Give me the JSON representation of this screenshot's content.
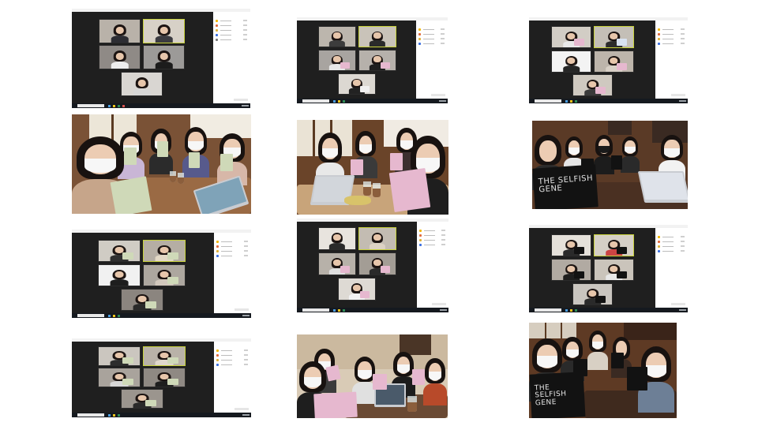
{
  "image": {
    "description_words": "collage of twelve photos and video-call screenshots of a reading group holding books",
    "grid": {
      "rows": 4,
      "columns": 3
    }
  },
  "book_cover": {
    "title": "THE SELFISH GENE"
  },
  "colors": {
    "zoom_stage": "#1f1f1f",
    "active_speaker_border": "#c7d13a",
    "pink_book": "#e6b8cf",
    "black_book": "#121212",
    "cafe_wall": "#7a5236"
  },
  "tiles": [
    {
      "kind": "zoom"
    },
    {
      "kind": "zoom"
    },
    {
      "kind": "zoom"
    },
    {
      "kind": "cafe-photo"
    },
    {
      "kind": "cafe-photo"
    },
    {
      "kind": "cafe-photo"
    },
    {
      "kind": "zoom"
    },
    {
      "kind": "zoom"
    },
    {
      "kind": "zoom"
    },
    {
      "kind": "zoom"
    },
    {
      "kind": "cafe-photo"
    },
    {
      "kind": "cafe-photo"
    }
  ]
}
